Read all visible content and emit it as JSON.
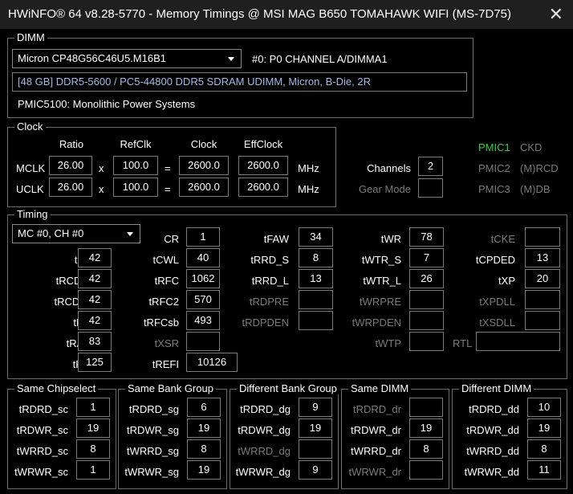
{
  "window": {
    "title": "HWiNFO® 64 v8.28-5770 - Memory Timings @ MSI MAG B650 TOMAHAWK WIFI (MS-7D75)"
  },
  "dimm": {
    "legend": "DIMM",
    "selected": "Micron CP48G56C46U5.M16B1",
    "slot": "#0: P0 CHANNEL A/DIMMA1",
    "info": "[48 GB] DDR5-5600 / PC5-44800 DDR5 SDRAM UDIMM, Micron, B-Die, 2R",
    "pmic": "PMIC5100: Monolithic Power Systems"
  },
  "clock": {
    "legend": "Clock",
    "headers": {
      "ratio": "Ratio",
      "refclk": "RefClk",
      "clock": "Clock",
      "effclock": "EffClock"
    },
    "mclk": {
      "label": "MCLK",
      "ratio": "26.00",
      "x": "x",
      "refclk": "100.0",
      "eq": "=",
      "clock": "2600.0",
      "eff": "2600.0",
      "unit": "MHz"
    },
    "uclk": {
      "label": "UCLK",
      "ratio": "26.00",
      "x": "x",
      "refclk": "100.0",
      "eq": "=",
      "clock": "2600.0",
      "eff": "2600.0",
      "unit": "MHz"
    },
    "channels_label": "Channels",
    "channels": "2",
    "gear_label": "Gear Mode",
    "gear": "",
    "pmic1": "PMIC1",
    "ckd": "CKD",
    "pmic2": "PMIC2",
    "mrcd": "(M)RCD",
    "pmic3": "PMIC3",
    "mdb": "(M)DB"
  },
  "timing": {
    "legend": "Timing",
    "selector": "MC #0, CH #0",
    "col1": [
      {
        "label": "tCL",
        "value": "42"
      },
      {
        "label": "tRCDrd",
        "value": "42"
      },
      {
        "label": "tRCDwr",
        "value": "42"
      },
      {
        "label": "tRP",
        "value": "42"
      },
      {
        "label": "tRAS",
        "value": "83"
      },
      {
        "label": "tRC",
        "value": "125"
      }
    ],
    "col2": [
      {
        "label": "CR",
        "value": "1"
      },
      {
        "label": "tCWL",
        "value": "40"
      },
      {
        "label": "tRFC",
        "value": "1062"
      },
      {
        "label": "tRFC2",
        "value": "570"
      },
      {
        "label": "tRFCsb",
        "value": "493"
      },
      {
        "label": "tXSR",
        "value": ""
      },
      {
        "label": "tREFI",
        "value": "10126"
      }
    ],
    "col3": [
      {
        "label": "tFAW",
        "value": "34"
      },
      {
        "label": "tRRD_S",
        "value": "8"
      },
      {
        "label": "tRRD_L",
        "value": "13"
      },
      {
        "label": "tRDPRE",
        "value": ""
      },
      {
        "label": "tRDPDEN",
        "value": ""
      }
    ],
    "col4": [
      {
        "label": "tWR",
        "value": "78"
      },
      {
        "label": "tWTR_S",
        "value": "7"
      },
      {
        "label": "tWTR_L",
        "value": "26"
      },
      {
        "label": "tWRPRE",
        "value": ""
      },
      {
        "label": "tWRPDEN",
        "value": ""
      },
      {
        "label": "tWTP",
        "value": ""
      }
    ],
    "col5": [
      {
        "label": "tCKE",
        "value": ""
      },
      {
        "label": "tCPDED",
        "value": "13"
      },
      {
        "label": "tXP",
        "value": "20"
      },
      {
        "label": "tXPDLL",
        "value": ""
      },
      {
        "label": "tXSDLL",
        "value": ""
      }
    ],
    "rtl_label": "RTL",
    "rtl": ""
  },
  "groups": {
    "same_chipselect": {
      "legend": "Same Chipselect",
      "rows": [
        {
          "label": "tRDRD_sc",
          "value": "1"
        },
        {
          "label": "tRDWR_sc",
          "value": "19"
        },
        {
          "label": "tWRRD_sc",
          "value": "8"
        },
        {
          "label": "tWRWR_sc",
          "value": "1"
        }
      ]
    },
    "same_bank_group": {
      "legend": "Same Bank Group",
      "rows": [
        {
          "label": "tRDRD_sg",
          "value": "6"
        },
        {
          "label": "tRDWR_sg",
          "value": "19"
        },
        {
          "label": "tWRRD_sg",
          "value": "8"
        },
        {
          "label": "tWRWR_sg",
          "value": "19"
        }
      ]
    },
    "different_bank_group": {
      "legend": "Different Bank Group",
      "rows": [
        {
          "label": "tRDRD_dg",
          "value": "9"
        },
        {
          "label": "tRDWR_dg",
          "value": "19"
        },
        {
          "label": "tWRRD_dg",
          "value": ""
        },
        {
          "label": "tWRWR_dg",
          "value": "9"
        }
      ]
    },
    "same_dimm": {
      "legend": "Same DIMM",
      "rows": [
        {
          "label": "tRDRD_dr",
          "value": ""
        },
        {
          "label": "tRDWR_dr",
          "value": "19"
        },
        {
          "label": "tWRRD_dr",
          "value": "8"
        },
        {
          "label": "tWRWR_dr",
          "value": ""
        }
      ]
    },
    "different_dimm": {
      "legend": "Different DIMM",
      "rows": [
        {
          "label": "tRDRD_dd",
          "value": "10"
        },
        {
          "label": "tRDWR_dd",
          "value": "19"
        },
        {
          "label": "tWRRD_dd",
          "value": "8"
        },
        {
          "label": "tWRWR_dd",
          "value": "11"
        }
      ]
    }
  },
  "colors": {
    "accent_green": "#3ad13a",
    "info_text": "#a9b7e8",
    "dim_text": "#7a7a7a",
    "border": "#7a7a7a"
  }
}
